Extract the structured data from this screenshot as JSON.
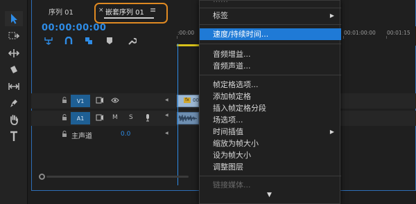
{
  "tabs": {
    "sequence": "序列 01",
    "nested_close": "×",
    "nested": "嵌套序列 01",
    "menu": "≡"
  },
  "timecode": "00:00:00:00",
  "ruler": {
    "start": ":00:00",
    "t1": "00:01:00:00",
    "t2": "00:01:15"
  },
  "tracks": {
    "v1": "V1",
    "a1": "A1",
    "a1_m": "M",
    "a1_s": "S",
    "master_label": "主声道",
    "master_value": "0.0",
    "clip_fx": "fx",
    "clip_label": "00"
  },
  "menu": {
    "items": [
      {
        "label": "标签",
        "submenu": true
      },
      {
        "label": "速度/持续时间...",
        "highlight": true
      },
      {
        "label": "音频增益..."
      },
      {
        "label": "音频声道..."
      },
      {
        "label": "帧定格选项..."
      },
      {
        "label": "添加帧定格"
      },
      {
        "label": "插入帧定格分段"
      },
      {
        "label": "场选项..."
      },
      {
        "label": "时间插值",
        "submenu": true
      },
      {
        "label": "缩放为帧大小"
      },
      {
        "label": "设为帧大小"
      },
      {
        "label": "调整图层"
      },
      {
        "label": "链接媒体...",
        "disabled": true
      }
    ],
    "submenu_arrow": "▶",
    "scroll_down": "▼"
  },
  "colors": {
    "accent": "#1f7ad6",
    "timecode": "#2e8ce6",
    "tab_highlight": "#e08a22",
    "track_button": "#1e5f94"
  },
  "icons": [
    "selection-tool-icon",
    "track-select-tool-icon",
    "ripple-edit-tool-icon",
    "razor-tool-icon",
    "slip-tool-icon",
    "pen-tool-icon",
    "hand-tool-icon",
    "type-tool-icon"
  ]
}
